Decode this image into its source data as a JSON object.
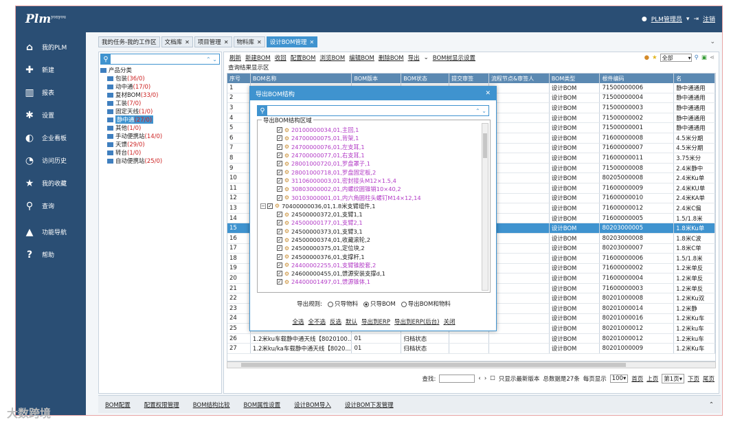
{
  "app": {
    "logo": "Plm",
    "logo_sup": "yonyou",
    "user": "PLM管理员",
    "logout": "注销"
  },
  "sidebar": {
    "items": [
      {
        "label": "我的PLM",
        "icon": "home-icon"
      },
      {
        "label": "新建",
        "icon": "plus-icon"
      },
      {
        "label": "报表",
        "icon": "chart-icon"
      },
      {
        "label": "设置",
        "icon": "gear-icon"
      },
      {
        "label": "企业看板",
        "icon": "dashboard-icon"
      },
      {
        "label": "访问历史",
        "icon": "history-icon"
      },
      {
        "label": "我的收藏",
        "icon": "star-icon"
      },
      {
        "label": "查询",
        "icon": "search-icon"
      },
      {
        "label": "功能导航",
        "icon": "navigate-icon"
      },
      {
        "label": "帮助",
        "icon": "help-icon"
      }
    ]
  },
  "tabs": [
    "我的任务-我的工作区",
    "文档库",
    "项目管理",
    "物料库",
    "设计BOM管理"
  ],
  "tree": {
    "root": "产品分类",
    "nodes": [
      {
        "label": "包装",
        "count": "(36/0)"
      },
      {
        "label": "动中通",
        "count": "(17/0)"
      },
      {
        "label": "复材BOM",
        "count": "(33/0)"
      },
      {
        "label": "工装",
        "count": "(7/0)"
      },
      {
        "label": "固定天线",
        "count": "(1/0)"
      },
      {
        "label": "静中通",
        "count": "(27/0)"
      },
      {
        "label": "其他",
        "count": "(1/0)"
      },
      {
        "label": "手动便携站",
        "count": "(14/0)"
      },
      {
        "label": "天馈",
        "count": "(29/0)"
      },
      {
        "label": "转台",
        "count": "(1/0)"
      },
      {
        "label": "自动便携站",
        "count": "(25/0)"
      }
    ]
  },
  "toolbar": {
    "buttons": [
      "刷新",
      "新建BOM",
      "收回",
      "配置BOM",
      "浏览BOM",
      "编辑BOM",
      "删除BOM",
      "导出",
      "BOM树显示设置"
    ],
    "filter": "全部"
  },
  "grid": {
    "title": "查询结果显示区",
    "headers": [
      "序号",
      "BOM名称",
      "BOM版本",
      "BOM状态",
      "提交审签",
      "流程节点&审签人",
      "BOM类型",
      "根件编码",
      "名"
    ],
    "rows": [
      {
        "n": "1",
        "type": "设计BOM",
        "code": "71500000006",
        "name": "静中通通用"
      },
      {
        "n": "2",
        "type": "设计BOM",
        "code": "71500000004",
        "name": "静中通通用"
      },
      {
        "n": "3",
        "type": "设计BOM",
        "code": "71500000003",
        "name": "静中通通用"
      },
      {
        "n": "4",
        "type": "设计BOM",
        "code": "71500000002",
        "name": "静中通通用"
      },
      {
        "n": "5",
        "type": "设计BOM",
        "code": "71500000001",
        "name": "静中通通用"
      },
      {
        "n": "6",
        "type": "设计BOM",
        "code": "71600000008",
        "name": "4.5米分期"
      },
      {
        "n": "7",
        "type": "设计BOM",
        "code": "71600000007",
        "name": "4.5米分期"
      },
      {
        "n": "8",
        "type": "设计BOM",
        "code": "71600000011",
        "name": "3.75米分"
      },
      {
        "n": "9",
        "type": "设计BOM",
        "code": "71500000008",
        "name": "2.4米静中"
      },
      {
        "n": "10",
        "type": "设计BOM",
        "code": "80205000008",
        "name": "2.4米Ku单"
      },
      {
        "n": "11",
        "type": "设计BOM",
        "code": "71600000009",
        "name": "2.4米KU单"
      },
      {
        "n": "12",
        "type": "设计BOM",
        "code": "71600000010",
        "name": "2.4米KA单"
      },
      {
        "n": "13",
        "type": "设计BOM",
        "code": "71600000012",
        "name": "2.4米C偏"
      },
      {
        "n": "14",
        "type": "设计BOM",
        "code": "71600000005",
        "name": "1.5/1.8米"
      },
      {
        "n": "15",
        "type": "设计BOM",
        "code": "80203000005",
        "name": "1.8米Ku单"
      },
      {
        "n": "16",
        "type": "设计BOM",
        "code": "80203000008",
        "name": "1.8米C波"
      },
      {
        "n": "17",
        "type": "设计BOM",
        "code": "80203000007",
        "name": "1.8米C单"
      },
      {
        "n": "18",
        "type": "设计BOM",
        "code": "71600000006",
        "name": "1.5/1.8米"
      },
      {
        "n": "19",
        "type": "设计BOM",
        "code": "71600000002",
        "name": "1.2米单反"
      },
      {
        "n": "20",
        "type": "设计BOM",
        "code": "71600000004",
        "name": "1.2米单反"
      },
      {
        "n": "21",
        "type": "设计BOM",
        "code": "71600000003",
        "name": "1.2米单反"
      },
      {
        "n": "22",
        "type": "设计BOM",
        "code": "80201000008",
        "name": "1.2米Ku双"
      },
      {
        "n": "23",
        "type": "设计BOM",
        "code": "80201000014",
        "name": "1.2米静"
      },
      {
        "n": "24",
        "type": "设计BOM",
        "code": "80201000016",
        "name": "1.2米Ku车"
      },
      {
        "n": "25",
        "bom": "",
        "ver": "",
        "state": "",
        "type": "设计BOM",
        "code": "80201000012",
        "name": "1.2米ku车"
      },
      {
        "n": "26",
        "bom": "1.2米ku车载静中通天线【8020100...",
        "ver": "01",
        "state": "归档状态",
        "type": "设计BOM",
        "code": "80201000012",
        "name": "1.2米ku车"
      },
      {
        "n": "27",
        "bom": "1.2米ku/ka车载静中通天线【8020...",
        "ver": "01",
        "state": "归档状态",
        "type": "设计BOM",
        "code": "80201000009",
        "name": "1.2米Ku车"
      }
    ]
  },
  "pager": {
    "find": "查找:",
    "latest": "只显示最新版本",
    "total": "总数据是27条",
    "per_page": "每页显示",
    "per_val": "100",
    "first": "首页",
    "prev": "上页",
    "page": "第1页",
    "next": "下页",
    "last": "尾页"
  },
  "bottom": [
    "BOM配置",
    "配置权限管理",
    "BOM结构比较",
    "BOM属性设置",
    "设计BOM导入",
    "设计BOM下发管理"
  ],
  "dialog": {
    "title": "导出BOM结构",
    "area_label": "导出BOM结构区域",
    "nodes": [
      {
        "label": "20100000034,01,主回,1",
        "purple": true
      },
      {
        "label": "24700000075,01,背架,1",
        "purple": true
      },
      {
        "label": "24700000076,01,左支耳,1",
        "purple": true
      },
      {
        "label": "24700000077,01,右支耳,1",
        "purple": true
      },
      {
        "label": "28001000720,01,罗盘罩子,1",
        "purple": true
      },
      {
        "label": "28001000718,01,罗盘固定板,2",
        "purple": true
      },
      {
        "label": "31106000003,01,密封接头M12×1.5,4",
        "purple": true
      },
      {
        "label": "30803000002,01,内螺纹圆锥销10×40,2",
        "purple": true
      },
      {
        "label": "30103000001,01,内六角圆柱头螺钉M14×12,14",
        "purple": true
      },
      {
        "label": "70400000036,01,1.8米支臂组件,1",
        "purple": false,
        "expander": true
      },
      {
        "label": "24500000372,01,支臂1,1",
        "purple": false
      },
      {
        "label": "24500000177,01,支臂2,1",
        "purple": true
      },
      {
        "label": "24500000373,01,支臂3,1",
        "purple": false
      },
      {
        "label": "24500000374,01,收藏滚轮,2",
        "purple": false
      },
      {
        "label": "24500000375,01,定位块,2",
        "purple": false
      },
      {
        "label": "24500000376,01,支撑杆,1",
        "purple": false
      },
      {
        "label": "24400002255,01,支臂锥胶套,2",
        "purple": true
      },
      {
        "label": "24600000455,01,馈源安装支撑d,1",
        "purple": false
      },
      {
        "label": "24400001497,01,馈源锥体,1",
        "purple": true
      }
    ],
    "rule_label": "导出规则:",
    "rules": [
      "只导物料",
      "只导BOM",
      "导出BOM和物料"
    ],
    "links": [
      "全选",
      "全不选",
      "反选",
      "默认",
      "导出到ERP",
      "导出到ERP(后台)",
      "关闭"
    ]
  },
  "watermark": "大数跨境"
}
